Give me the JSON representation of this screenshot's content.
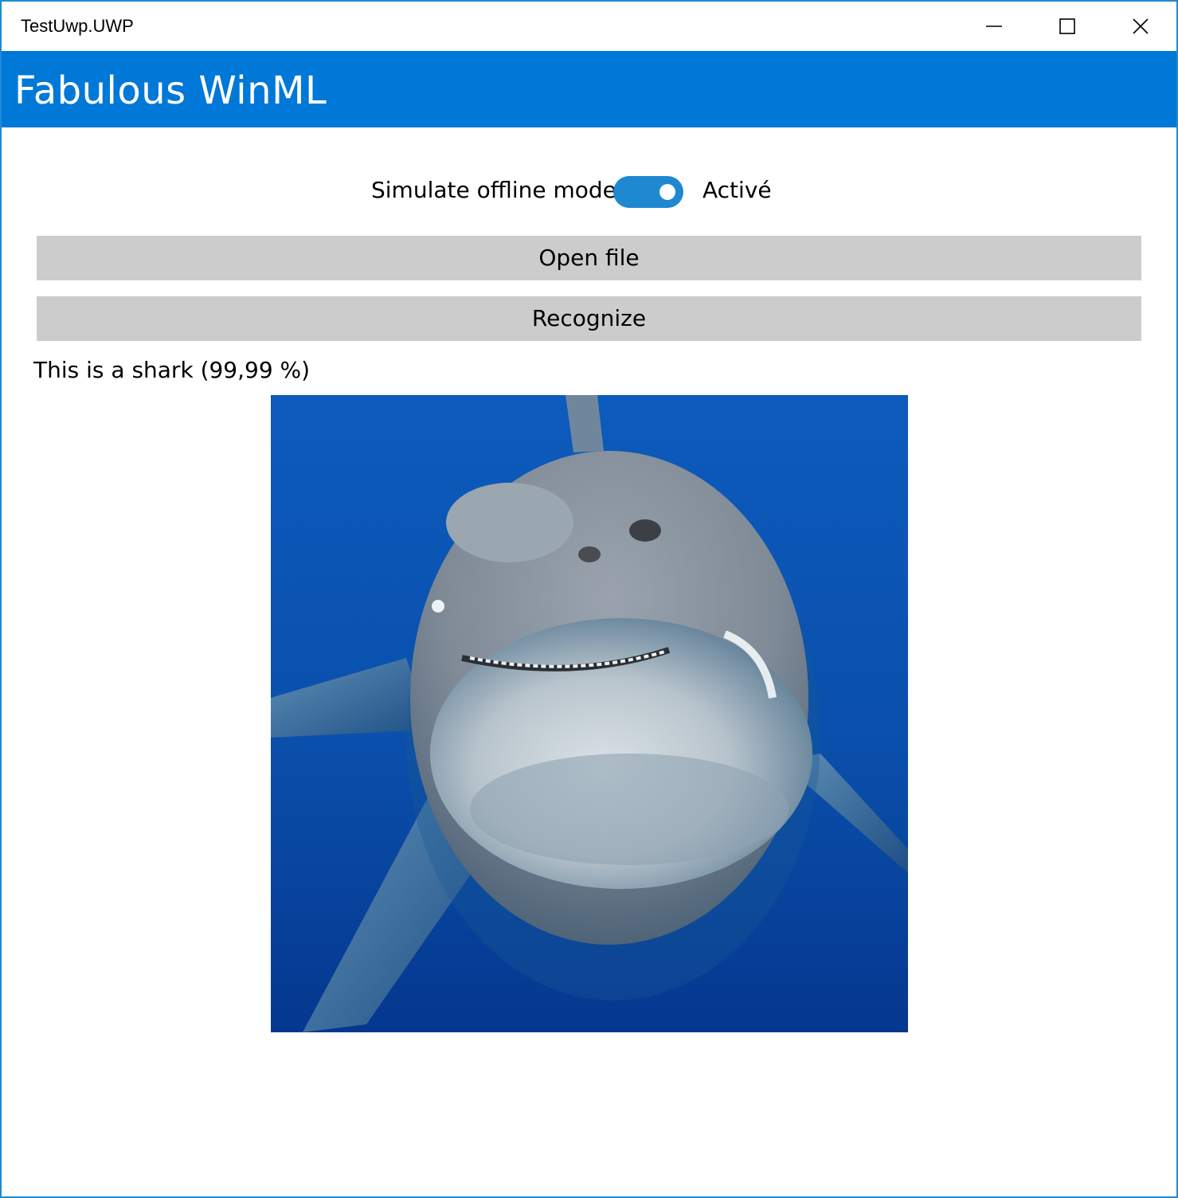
{
  "window": {
    "title": "TestUwp.UWP",
    "accent_color": "#0078d7"
  },
  "caption_buttons": {
    "minimize_icon": "minimize-icon",
    "maximize_icon": "maximize-icon",
    "close_icon": "close-icon"
  },
  "app": {
    "title": "Fabulous WinML"
  },
  "offline_toggle": {
    "label": "Simulate offline mode",
    "state_text": "Activé",
    "is_on": true,
    "on_color": "#1e88d0"
  },
  "buttons": {
    "open_file": "Open file",
    "recognize": "Recognize",
    "background": "#cccccc"
  },
  "result": {
    "text": "This is a shark (99,99 %)"
  },
  "image": {
    "subject": "shark-photo",
    "water_color": "#0b4fa8"
  }
}
